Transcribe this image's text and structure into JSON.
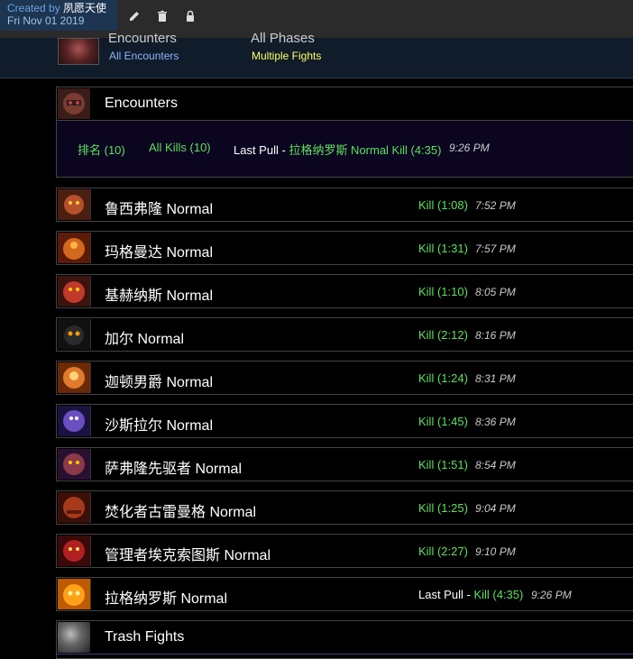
{
  "topbar": {
    "created_label": "Created by",
    "creator": "夙愿天使",
    "date": "Fri Nov 01 2019",
    "icons": [
      "pencil-icon",
      "trash-icon",
      "lock-icon"
    ]
  },
  "header": {
    "cut_left": "Encounters",
    "cut_right": "All Phases",
    "encounter_filter": "All Encounters",
    "fight_filter": "Multiple Fights"
  },
  "encounters": {
    "title": "Encounters",
    "filter_rank": "排名 (10)",
    "filter_kills": "All Kills (10)",
    "last_pull_label": "Last Pull",
    "last_pull_sep": " - ",
    "last_pull_value": "拉格纳罗斯 Normal Kill (4:35)",
    "last_pull_time": "9:26 PM"
  },
  "bosses": [
    {
      "name": "鲁西弗隆 Normal",
      "result": "Kill (1:08)",
      "time": "7:52 PM"
    },
    {
      "name": "玛格曼达 Normal",
      "result": "Kill (1:31)",
      "time": "7:57 PM"
    },
    {
      "name": "基赫纳斯 Normal",
      "result": "Kill (1:10)",
      "time": "8:05 PM"
    },
    {
      "name": "加尔 Normal",
      "result": "Kill (2:12)",
      "time": "8:16 PM"
    },
    {
      "name": "迦顿男爵 Normal",
      "result": "Kill (1:24)",
      "time": "8:31 PM"
    },
    {
      "name": "沙斯拉尔 Normal",
      "result": "Kill (1:45)",
      "time": "8:36 PM"
    },
    {
      "name": "萨弗隆先驱者 Normal",
      "result": "Kill (1:51)",
      "time": "8:54 PM"
    },
    {
      "name": "焚化者古雷曼格 Normal",
      "result": "Kill (1:25)",
      "time": "9:04 PM"
    },
    {
      "name": "管理者埃克索图斯 Normal",
      "result": "Kill (2:27)",
      "time": "9:10 PM"
    }
  ],
  "final_boss": {
    "name": "拉格纳罗斯 Normal",
    "last_pull_label": "Last Pull",
    "sep": " - ",
    "result": "Kill (4:35)",
    "time": "9:26 PM"
  },
  "trash": {
    "title": "Trash Fights"
  },
  "colors": {
    "kill": "#5ee05e",
    "link_blue": "#8fb3ff",
    "link_yellow": "#ffff66"
  }
}
